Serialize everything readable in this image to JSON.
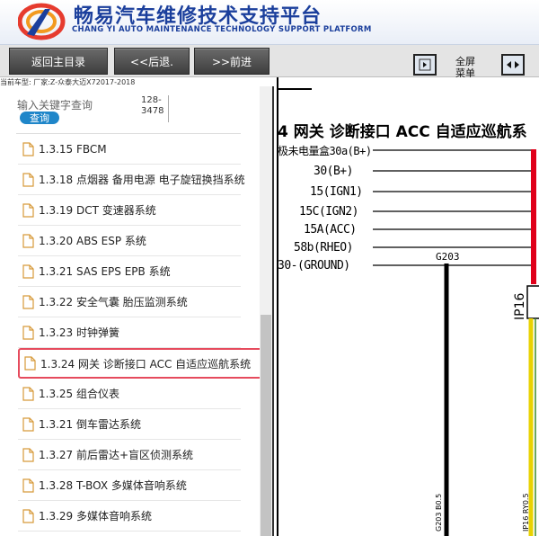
{
  "header": {
    "title": "畅易汽车维修技术支持平台",
    "subtitle": "CHANG YI AUTO MAINTENANCE TECHNOLOGY SUPPORT PLATFORM"
  },
  "toolbar": {
    "back_main": "返回主目录",
    "back": "<<后退.",
    "forward": ">>前进",
    "fullscreen_line1": "全屏",
    "fullscreen_line2": "菜单"
  },
  "current_model": "当前车型:  厂家:Z-众泰大迈X72017-2018",
  "search": {
    "placeholder": "输入关键字查询",
    "button": "查询",
    "count_line1": "128-",
    "count_line2": "3478"
  },
  "toc": [
    {
      "label": "1.3.15 FBCM"
    },
    {
      "label": "1.3.18 点烟器 备用电源 电子旋钮换挡系统"
    },
    {
      "label": "1.3.19 DCT 变速器系统"
    },
    {
      "label": "1.3.20 ABS ESP 系统"
    },
    {
      "label": "1.3.21 SAS EPS EPB 系统"
    },
    {
      "label": "1.3.22 安全气囊 胎压监测系统"
    },
    {
      "label": "1.3.23 时钟弹簧"
    },
    {
      "label": "1.3.24 网关 诊断接口 ACC 自适应巡航系统"
    },
    {
      "label": "1.3.25 组合仪表"
    },
    {
      "label": "1.3.21 倒车雷达系统"
    },
    {
      "label": "1.3.27 前后雷达+盲区侦测系统"
    },
    {
      "label": "1.3.28 T-BOX 多媒体音响系统"
    },
    {
      "label": "1.3.29 多媒体音响系统"
    }
  ],
  "diagram": {
    "heading": "4 网关 诊断接口 ACC 自适应巡航系",
    "wires": [
      {
        "label": "极未电量盒30a(B+)"
      },
      {
        "label": "30(B+)"
      },
      {
        "label": "15(IGN1)"
      },
      {
        "label": "15C(IGN2)"
      },
      {
        "label": "15A(ACC)"
      },
      {
        "label": "58b(RHEO)"
      },
      {
        "label": "30-(GROUND)"
      }
    ],
    "ground_label": "G203",
    "connector_label": "IP16",
    "ground_pin": "G203 B0.5",
    "connector_pin": "IP16 RY0.5"
  },
  "colors": {
    "brand": "#1b3f9c",
    "highlight_border": "#e64b5d",
    "search_button": "#1f86c9",
    "wire_red": "#e0001a",
    "wire_yellow": "#e8d200"
  }
}
